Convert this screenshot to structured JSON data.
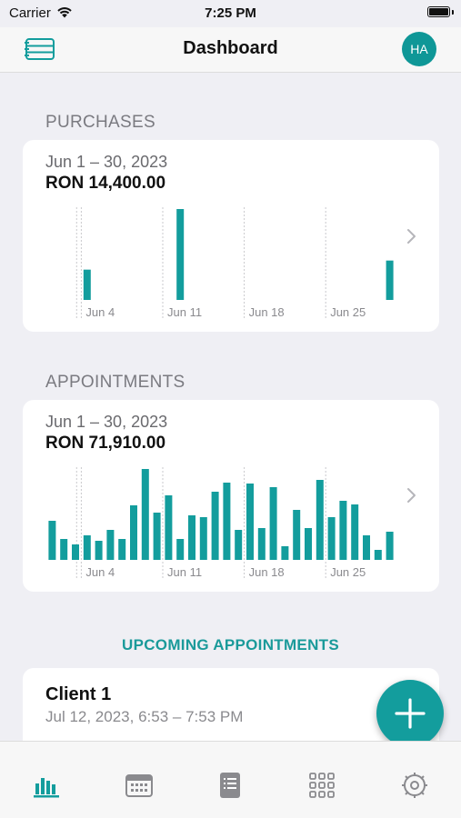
{
  "status_bar": {
    "carrier": "Carrier",
    "time": "7:25 PM"
  },
  "header": {
    "title": "Dashboard",
    "avatar_initials": "HA"
  },
  "purchases": {
    "section_title": "PURCHASES",
    "date_range": "Jun 1 – 30, 2023",
    "total": "RON 14,400.00"
  },
  "appointments": {
    "section_title": "APPOINTMENTS",
    "date_range": "Jun 1 – 30, 2023",
    "total": "RON 71,910.00"
  },
  "upcoming": {
    "section_title": "UPCOMING APPOINTMENTS",
    "items": [
      {
        "client": "Client 1",
        "time": "Jul 12, 2023, 6:53 – 7:53 PM"
      }
    ]
  },
  "tabs": [
    {
      "name": "tab-dashboard",
      "icon": "bar-chart-icon",
      "active": true
    },
    {
      "name": "tab-calendar",
      "icon": "calendar-icon",
      "active": false
    },
    {
      "name": "tab-list",
      "icon": "list-icon",
      "active": false
    },
    {
      "name": "tab-grid",
      "icon": "grid-icon",
      "active": false
    },
    {
      "name": "tab-settings",
      "icon": "gear-icon",
      "active": false
    }
  ],
  "colors": {
    "accent": "#139d9d",
    "bar": "#139d9d"
  },
  "chart_data": [
    {
      "type": "bar",
      "title": "",
      "x_tick_labels": [
        "Jun 4",
        "Jun 11",
        "Jun 18",
        "Jun 25"
      ],
      "x_tick_days": [
        4,
        11,
        18,
        25
      ],
      "series": [
        {
          "x": [
            1,
            2,
            3,
            4,
            5,
            6,
            7,
            8,
            9,
            10,
            11,
            12,
            13,
            14,
            15,
            16,
            17,
            18,
            19,
            20,
            21,
            22,
            23,
            24,
            25,
            26,
            27,
            28,
            29,
            30
          ],
          "values": [
            0,
            0,
            0,
            1,
            0,
            0,
            0,
            0,
            0,
            0,
            0,
            3,
            0,
            0,
            0,
            0,
            0,
            0,
            0,
            0,
            0,
            0,
            0,
            0,
            0,
            0,
            0,
            0,
            0,
            1.3
          ]
        }
      ],
      "ylim": [
        0,
        3
      ],
      "grid": "vertical"
    },
    {
      "type": "bar",
      "title": "",
      "x_tick_labels": [
        "Jun 4",
        "Jun 11",
        "Jun 18",
        "Jun 25"
      ],
      "x_tick_days": [
        4,
        11,
        18,
        25
      ],
      "series": [
        {
          "x": [
            1,
            2,
            3,
            4,
            5,
            6,
            7,
            8,
            9,
            10,
            11,
            12,
            13,
            14,
            15,
            16,
            17,
            18,
            19,
            20,
            21,
            22,
            23,
            24,
            25,
            26,
            27,
            28,
            29,
            30
          ],
          "values": [
            43,
            23,
            17,
            27,
            21,
            33,
            23,
            60,
            100,
            52,
            71,
            23,
            49,
            47,
            75,
            85,
            33,
            84,
            35,
            80,
            15,
            55,
            35,
            88,
            47,
            65,
            61,
            27,
            11,
            31
          ]
        }
      ],
      "ylim": [
        0,
        100
      ],
      "grid": "vertical"
    }
  ]
}
